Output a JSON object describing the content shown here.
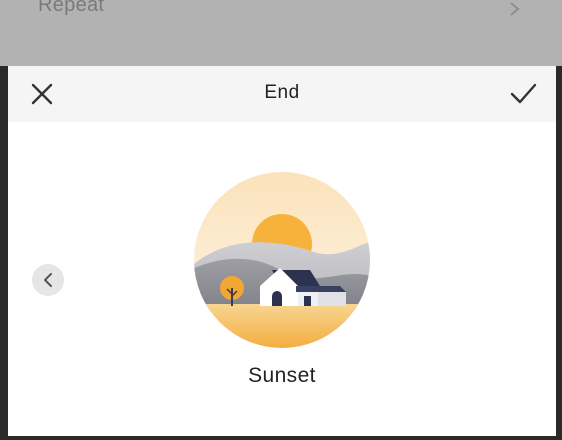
{
  "background": {
    "row_label": "Repeat",
    "chevron_icon": "chevron-right-icon"
  },
  "dialog": {
    "title": "End",
    "close_icon": "close-icon",
    "confirm_icon": "check-icon"
  },
  "carousel": {
    "prev_icon": "chevron-left-icon",
    "selected_label": "Sunset"
  },
  "colors": {
    "header_bg": "#f5f5f5",
    "sun": "#f7b23b",
    "ground": "#f6c15a",
    "hills": "#a9a9ad"
  }
}
